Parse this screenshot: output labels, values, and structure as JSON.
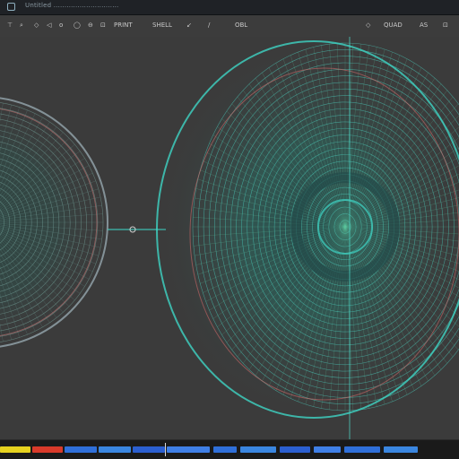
{
  "window": {
    "title": "Untitled ..............................",
    "icon": "app-logo-icon"
  },
  "toolbar": {
    "items": [
      "⊤",
      "⌕",
      "◇",
      "◁",
      "o",
      "◯",
      "⊖",
      "⊡",
      "PRINT",
      "SHELL",
      "↙",
      "/",
      "",
      "OBL"
    ],
    "right_items": [
      "◇",
      "QUAD",
      "AS",
      "⊡"
    ]
  },
  "viewport": {
    "mesh_colors": {
      "primary": "#3fd6c6",
      "secondary": "#5ec8a0",
      "accent": "#d96b6b",
      "outline": "#9fb3bd"
    }
  },
  "statusbar": {
    "segments": [
      {
        "color": "#e6d21f"
      },
      {
        "color": "#d93a2a"
      },
      {
        "color": "#2f6fd9"
      },
      {
        "color": "#3a86e0"
      },
      {
        "color": "#2b5fd0"
      },
      {
        "color": "#3f7fe6"
      },
      {
        "color": "#2f6fd9"
      },
      {
        "color": "#3a86e0"
      },
      {
        "color": "#2b5fd0"
      },
      {
        "color": "#3f7fe6"
      },
      {
        "color": "#2f6fd9"
      },
      {
        "color": "#3a86e0"
      }
    ]
  }
}
